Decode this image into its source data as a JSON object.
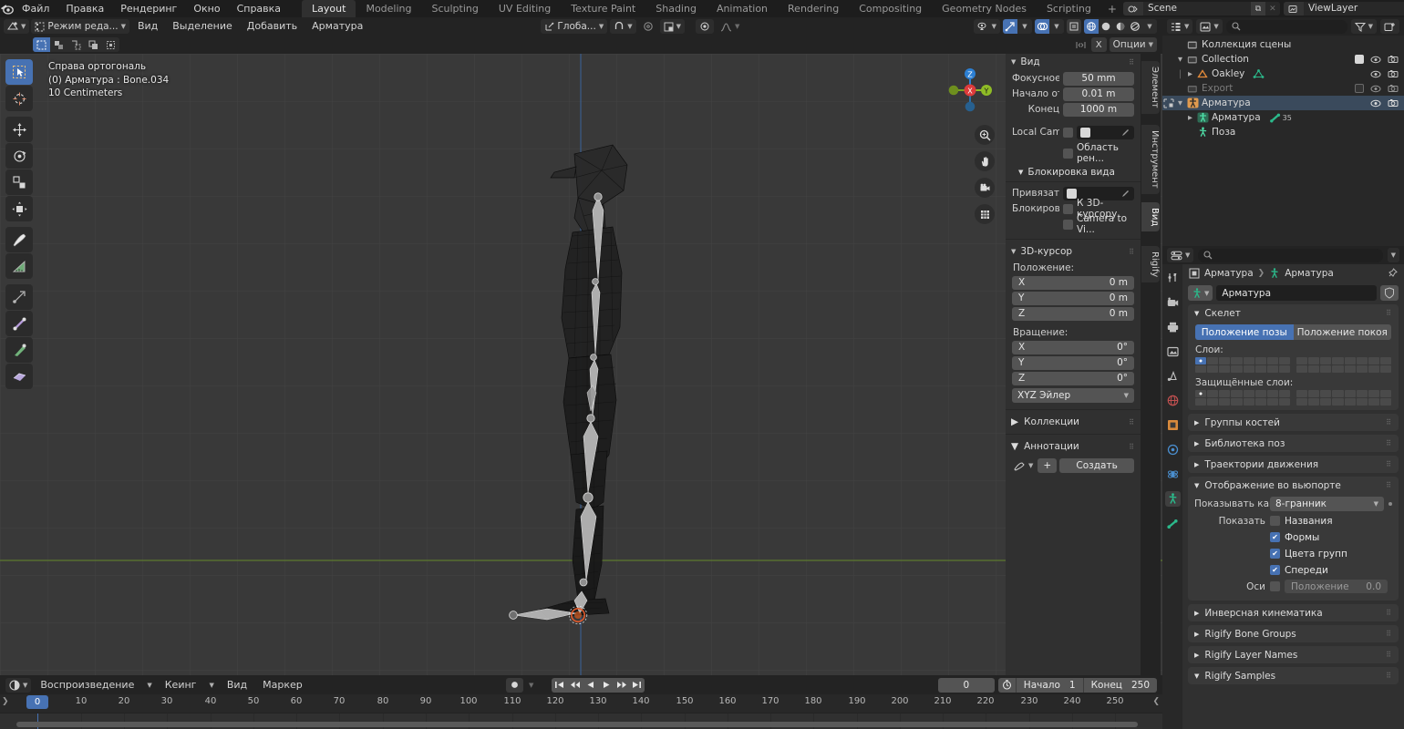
{
  "topbar": {
    "logo_icon": "blender-logo-icon",
    "menus": [
      "Файл",
      "Правка",
      "Рендеринг",
      "Окно",
      "Справка"
    ],
    "workspaces": [
      {
        "label": "Layout",
        "active": true
      },
      {
        "label": "Modeling",
        "active": false
      },
      {
        "label": "Sculpting",
        "active": false
      },
      {
        "label": "UV Editing",
        "active": false
      },
      {
        "label": "Texture Paint",
        "active": false
      },
      {
        "label": "Shading",
        "active": false
      },
      {
        "label": "Animation",
        "active": false
      },
      {
        "label": "Rendering",
        "active": false
      },
      {
        "label": "Compositing",
        "active": false
      },
      {
        "label": "Geometry Nodes",
        "active": false
      },
      {
        "label": "Scripting",
        "active": false
      }
    ],
    "add_workspace": "+",
    "scene": {
      "label": "Scene",
      "icon": "scene-icon",
      "copy_icon": "new-scene-icon",
      "close_icon": "unlink-icon"
    },
    "viewlayer": {
      "label": "ViewLayer",
      "icon": "viewlayer-icon",
      "copy_icon": "new-viewlayer-icon",
      "close_icon": "remove-viewlayer-icon"
    }
  },
  "viewport_header": {
    "editor_type_icon": "editor-type-3dview-icon",
    "mode": "Режим реда...",
    "menus": [
      "Вид",
      "Выделение",
      "Добавить",
      "Арматура"
    ],
    "transform_orientation": "Глоба...",
    "snap_icon": "magnet-icon",
    "proportional_icon": "proportional-edit-icon",
    "pivot_icon": "pivot-point-icon",
    "mirror_icon": "xray-icon",
    "falloff_icon": "falloff-curve-icon",
    "visibility_icon": "visibility-selector-icon",
    "gizmo_icon": "gizmo-icon",
    "overlays_icon": "overlays-icon",
    "xray_icon": "toggle-xray-icon",
    "shading_modes": [
      "wireframe-shading-icon",
      "solid-shading-icon",
      "material-preview-icon",
      "rendered-shading-icon"
    ],
    "select_modes": [
      "vertex-select-icon",
      "edge-select-icon",
      "face-select-icon",
      "box-select-icon",
      "circle-select-icon"
    ],
    "options_label": "Опции",
    "mirror_x_label": "X",
    "mirror_topology_icon": "topology-mirror-icon"
  },
  "viewport": {
    "overlay_lines": [
      "Справа ортогональ",
      "(0) Арматура : Bone.034",
      "10 Centimeters"
    ],
    "gizmo_axes": [
      {
        "label": "Z",
        "color": "#2c7fd3"
      },
      {
        "label": "Y",
        "color": "#8fbc26"
      },
      {
        "label": "X",
        "color": "#dd3b3b"
      }
    ],
    "nav_buttons": [
      "zoom-icon",
      "pan-hand-icon",
      "camera-view-icon",
      "toggle-ortho-persp-icon"
    ],
    "tools": [
      {
        "name": "tweak-select-tool",
        "active": true
      },
      {
        "name": "cursor-tool",
        "active": false
      },
      {
        "name": "move-tool",
        "active": false
      },
      {
        "name": "rotate-tool",
        "active": false
      },
      {
        "name": "scale-tool",
        "active": false
      },
      {
        "name": "transform-tool",
        "active": false
      },
      {
        "name": "annotate-tool",
        "active": false
      },
      {
        "name": "measure-tool",
        "active": false
      },
      {
        "name": "extrude-tool",
        "active": false
      },
      {
        "name": "bone-size-tool",
        "active": false
      },
      {
        "name": "bone-roll-tool",
        "active": false
      },
      {
        "name": "bone-envelope-tool",
        "active": false
      }
    ]
  },
  "npanel": {
    "tabs": [
      {
        "label": "Элемент",
        "active": false
      },
      {
        "label": "Инструмент",
        "active": false
      },
      {
        "label": "Вид",
        "active": true
      },
      {
        "label": "Rigify",
        "active": false
      }
    ],
    "view_section": {
      "title": "Вид",
      "rows": [
        {
          "label": "Фокусное ...",
          "value": "50 mm"
        },
        {
          "label": "Начало от...",
          "value": "0.01 m"
        },
        {
          "label": "Конец",
          "value": "1000 m"
        }
      ],
      "local_camera_label": "Local Cam...",
      "render_region_label": "Область рен...",
      "view_lock_title": "Блокировка вида",
      "lock_to_object_label": "Привязать...",
      "lock_label": "Блокировка",
      "lock_cursor_label": "К 3D-курсору",
      "camera_to_view_label": "Camera to Vi..."
    },
    "cursor_section": {
      "title": "3D-курсор",
      "location_label": "Положение:",
      "location": [
        {
          "axis": "X",
          "value": "0 m"
        },
        {
          "axis": "Y",
          "value": "0 m"
        },
        {
          "axis": "Z",
          "value": "0 m"
        }
      ],
      "rotation_label": "Вращение:",
      "rotation": [
        {
          "axis": "X",
          "value": "0°"
        },
        {
          "axis": "Y",
          "value": "0°"
        },
        {
          "axis": "Z",
          "value": "0°"
        }
      ],
      "rotation_mode": "XYZ Эйлер"
    },
    "collections_title": "Коллекции",
    "annotations_title": "Аннотации",
    "annotations_new": "Создать",
    "annotations_plus": "+"
  },
  "outliner": {
    "display_mode_icon": "outliner-display-mode-icon",
    "filter_id_icon": "filter-id-icon",
    "search_placeholder": "",
    "filter_icon": "filter-funnel-icon",
    "new_collection_icon": "new-collection-icon",
    "rows": [
      {
        "indent": 0,
        "tri": "",
        "icon": "scene-collection-icon",
        "name": "Коллекция сцены",
        "checkbox": null,
        "eye": false,
        "camera": false,
        "dim": false,
        "selected": false
      },
      {
        "indent": 1,
        "tri": "▼",
        "icon": "collection-icon",
        "name": "Collection",
        "checkbox": true,
        "eye": true,
        "camera": true,
        "dim": false,
        "selected": false
      },
      {
        "indent": 2,
        "tri": "▶",
        "icon": "mesh-object-icon",
        "name": "Oakley",
        "checkbox": null,
        "eye": true,
        "camera": true,
        "dim": false,
        "selected": false,
        "extra_icon": "mesh-data-icon"
      },
      {
        "indent": 1,
        "tri": "",
        "icon": "collection-icon",
        "name": "Export",
        "checkbox": false,
        "eye": true,
        "camera": true,
        "dim": true,
        "selected": false
      },
      {
        "indent": 1,
        "tri": "▼",
        "icon": "armature-object-icon",
        "name": "Арматура",
        "checkbox": null,
        "eye": true,
        "camera": true,
        "dim": false,
        "selected": true
      },
      {
        "indent": 2,
        "tri": "▶",
        "icon": "armature-data-icon",
        "name": "Арматура",
        "checkbox": null,
        "eye": false,
        "camera": false,
        "dim": false,
        "selected": false,
        "extra_icon": "bone-icon",
        "extra_count": "35"
      },
      {
        "indent": 2,
        "tri": "",
        "icon": "pose-icon",
        "name": "Поза",
        "checkbox": null,
        "eye": false,
        "camera": false,
        "dim": false,
        "selected": false
      }
    ]
  },
  "properties": {
    "editor_icon": "properties-editor-icon",
    "search_placeholder": "",
    "tabs": [
      {
        "name": "tool-tab",
        "icon": "tool-icon",
        "active": false
      },
      {
        "name": "render-tab",
        "icon": "render-camera-icon",
        "active": false
      },
      {
        "name": "output-tab",
        "icon": "printer-icon",
        "active": false
      },
      {
        "name": "viewlayer-tab",
        "icon": "images-icon",
        "active": false
      },
      {
        "name": "scene-tab",
        "icon": "scene-cone-icon",
        "active": false
      },
      {
        "name": "world-tab",
        "icon": "world-globe-icon",
        "active": false
      },
      {
        "name": "object-tab",
        "icon": "object-square-icon",
        "active": false
      },
      {
        "name": "modifier-tab",
        "icon": "wrench-icon",
        "active": false
      },
      {
        "name": "physics-tab",
        "icon": "physics-orbit-icon",
        "active": false
      },
      {
        "name": "data-tab",
        "icon": "armature-data-icon",
        "active": true
      },
      {
        "name": "bone-tab",
        "icon": "bone-icon",
        "active": false
      }
    ],
    "breadcrumb": [
      {
        "icon": "object-icon",
        "label": "Арматура"
      },
      {
        "icon": "armature-data-icon",
        "label": "Арматура"
      }
    ],
    "pin_icon": "pin-icon",
    "id_block": {
      "icon": "armature-data-icon",
      "name": "Арматура",
      "shield_icon": "fake-user-icon"
    },
    "skeleton": {
      "title": "Скелет",
      "pose_position": "Положение позы",
      "rest_position": "Положение покоя",
      "pose_active": true,
      "layers_label": "Слои:",
      "layers_active_index": 0,
      "protected_label": "Защищённые слои:",
      "protected_active_index": 0
    },
    "sections": [
      {
        "title": "Группы костей",
        "open": false
      },
      {
        "title": "Библиотека поз",
        "open": false
      },
      {
        "title": "Траектории движения",
        "open": false
      }
    ],
    "viewport_display": {
      "title": "Отображение во вьюпорте",
      "display_as_label": "Показывать как",
      "display_as_value": "8-гранник",
      "show_label": "Показать",
      "checkboxes": [
        {
          "label": "Названия",
          "checked": false
        },
        {
          "label": "Формы",
          "checked": true
        },
        {
          "label": "Цвета групп",
          "checked": true
        },
        {
          "label": "Спереди",
          "checked": true
        }
      ],
      "axes_label": "Оси",
      "axes_checked": false,
      "axes_field_label": "Положение",
      "axes_field_value": "0.0"
    },
    "sections_bottom": [
      {
        "title": "Инверсная кинематика",
        "open": false
      },
      {
        "title": "Rigify Bone Groups",
        "open": false
      },
      {
        "title": "Rigify Layer Names",
        "open": false
      },
      {
        "title": "Rigify Samples",
        "open": true
      }
    ]
  },
  "timeline": {
    "editor_icon": "timeline-editor-icon",
    "menus": [
      "Воспроизведение",
      "Кеинг",
      "Вид",
      "Маркер"
    ],
    "record_icon": "auto-keying-icon",
    "playback_buttons": [
      "jump-to-start-icon",
      "prev-keyframe-icon",
      "play-reverse-icon",
      "play-icon",
      "next-keyframe-icon",
      "jump-to-end-icon"
    ],
    "current_frame": "0",
    "timer_icon": "use-preview-range-icon",
    "start_label": "Начало",
    "start_value": "1",
    "end_label": "Конец",
    "end_value": "250",
    "ticks": [
      0,
      10,
      20,
      30,
      40,
      50,
      60,
      70,
      80,
      90,
      100,
      110,
      120,
      130,
      140,
      150,
      160,
      170,
      180,
      190,
      200,
      210,
      220,
      230,
      240,
      250
    ],
    "playhead_frame": 0
  },
  "colors": {
    "accent": "#4772b3",
    "axis_x": "#dd3b3b",
    "axis_y": "#8fbc26",
    "axis_z": "#2c7fd3",
    "viewport_bg": "#393939",
    "panel_bg": "#303030",
    "header_bg": "#232323",
    "outliner_bg": "#282828"
  }
}
